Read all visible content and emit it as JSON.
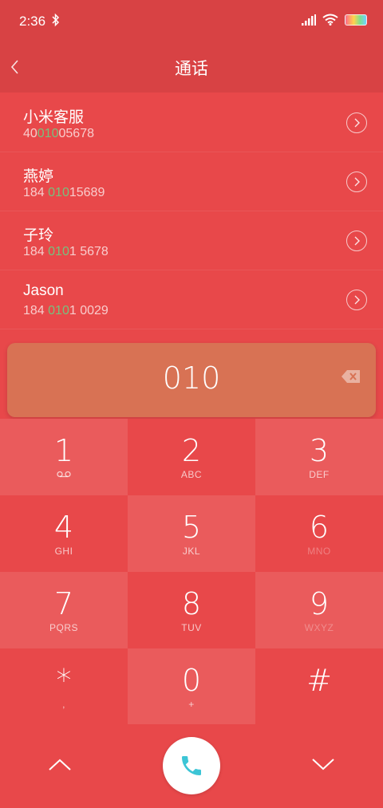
{
  "status": {
    "time": "2:36",
    "icons": [
      "bluetooth-icon",
      "signal-icon",
      "wifi-icon",
      "battery-icon"
    ]
  },
  "header": {
    "title": "通话",
    "back_icon": "chevron-left-icon"
  },
  "contacts": [
    {
      "name": "小米客服",
      "number_pre": "40",
      "number_hl": "010",
      "number_post": "05678"
    },
    {
      "name": "燕婷",
      "number_pre": "184 ",
      "number_hl": "010",
      "number_post": "15689"
    },
    {
      "name": "子玲",
      "number_pre": "184 ",
      "number_hl": "010",
      "number_post": "1 5678"
    },
    {
      "name": "Jason",
      "number_pre": "184 ",
      "number_hl": "010",
      "number_post": "1 0029"
    }
  ],
  "input": {
    "typed": "010",
    "backspace_icon": "backspace-icon"
  },
  "keypad": [
    {
      "digit": "1",
      "letters": ""
    },
    {
      "digit": "2",
      "letters": "ABC"
    },
    {
      "digit": "3",
      "letters": "DEF"
    },
    {
      "digit": "4",
      "letters": "GHI"
    },
    {
      "digit": "5",
      "letters": "JKL"
    },
    {
      "digit": "6",
      "letters": "MNO"
    },
    {
      "digit": "7",
      "letters": "PQRS"
    },
    {
      "digit": "8",
      "letters": "TUV"
    },
    {
      "digit": "9",
      "letters": "WXYZ"
    },
    {
      "digit": "*",
      "letters": ","
    },
    {
      "digit": "0",
      "letters": "+"
    },
    {
      "digit": "#",
      "letters": ""
    }
  ],
  "bottom": {
    "up_icon": "chevron-up-icon",
    "call_icon": "phone-icon",
    "down_icon": "chevron-down-icon"
  },
  "colors": {
    "background": "#E8484A",
    "header": "#D84244",
    "input_bar": "#D87254",
    "match_highlight": "#78C07E",
    "call_icon": "#3CC5D6"
  }
}
